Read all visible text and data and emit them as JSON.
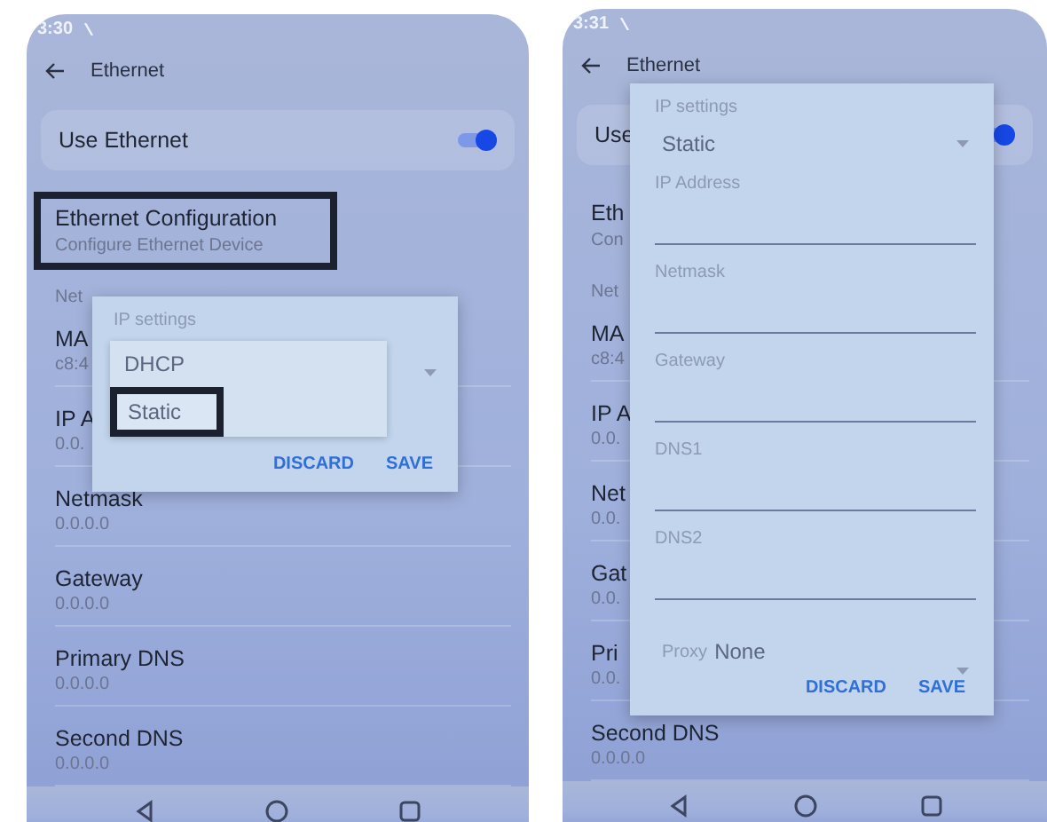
{
  "screens": [
    {
      "status_time": "3:30",
      "title": "Ethernet",
      "toggle_row": {
        "label": "Use Ethernet",
        "on": true
      },
      "config": {
        "title": "Ethernet Configuration",
        "subtitle": "Configure Ethernet Device",
        "highlighted": true
      },
      "section": "Net",
      "rows": [
        {
          "label": "MA",
          "value": "c8:4"
        },
        {
          "label": "IP A",
          "value": "0.0."
        },
        {
          "label": "Netmask",
          "value": "0.0.0.0"
        },
        {
          "label": "Gateway",
          "value": "0.0.0.0"
        },
        {
          "label": "Primary DNS",
          "value": "0.0.0.0"
        },
        {
          "label": "Second DNS",
          "value": "0.0.0.0"
        }
      ],
      "dialog": {
        "kind": "picker",
        "items": [
          {
            "kind": "menu",
            "label": "IP settings",
            "options": [
              {
                "label": "DHCP",
                "highlighted": false
              },
              {
                "label": "Static",
                "highlighted": true
              }
            ]
          }
        ],
        "buttons": [
          "DISCARD",
          "SAVE"
        ]
      }
    },
    {
      "status_time": "3:31",
      "title": "Ethernet",
      "toggle_row": {
        "label": "Use",
        "on": true
      },
      "config": {
        "title": "Eth",
        "subtitle": "Con",
        "highlighted": false
      },
      "section": "Net",
      "rows": [
        {
          "label": "MA",
          "value": "c8:4"
        },
        {
          "label": "IP A",
          "value": "0.0."
        },
        {
          "label": "Net",
          "value": "0.0."
        },
        {
          "label": "Gat",
          "value": "0.0."
        },
        {
          "label": "Pri",
          "value": "0.0."
        },
        {
          "label": "Second DNS",
          "value": "0.0.0.0"
        }
      ],
      "dialog": {
        "kind": "form",
        "items": [
          {
            "kind": "select",
            "label": "IP settings",
            "value": "Static"
          },
          {
            "kind": "field",
            "label": "IP Address"
          },
          {
            "kind": "field",
            "label": "Netmask"
          },
          {
            "kind": "field",
            "label": "Gateway"
          },
          {
            "kind": "field",
            "label": "DNS1"
          },
          {
            "kind": "field",
            "label": "DNS2"
          },
          {
            "kind": "inline_select",
            "label": "Proxy",
            "value": "None"
          }
        ],
        "buttons": [
          "DISCARD",
          "SAVE"
        ]
      }
    }
  ]
}
